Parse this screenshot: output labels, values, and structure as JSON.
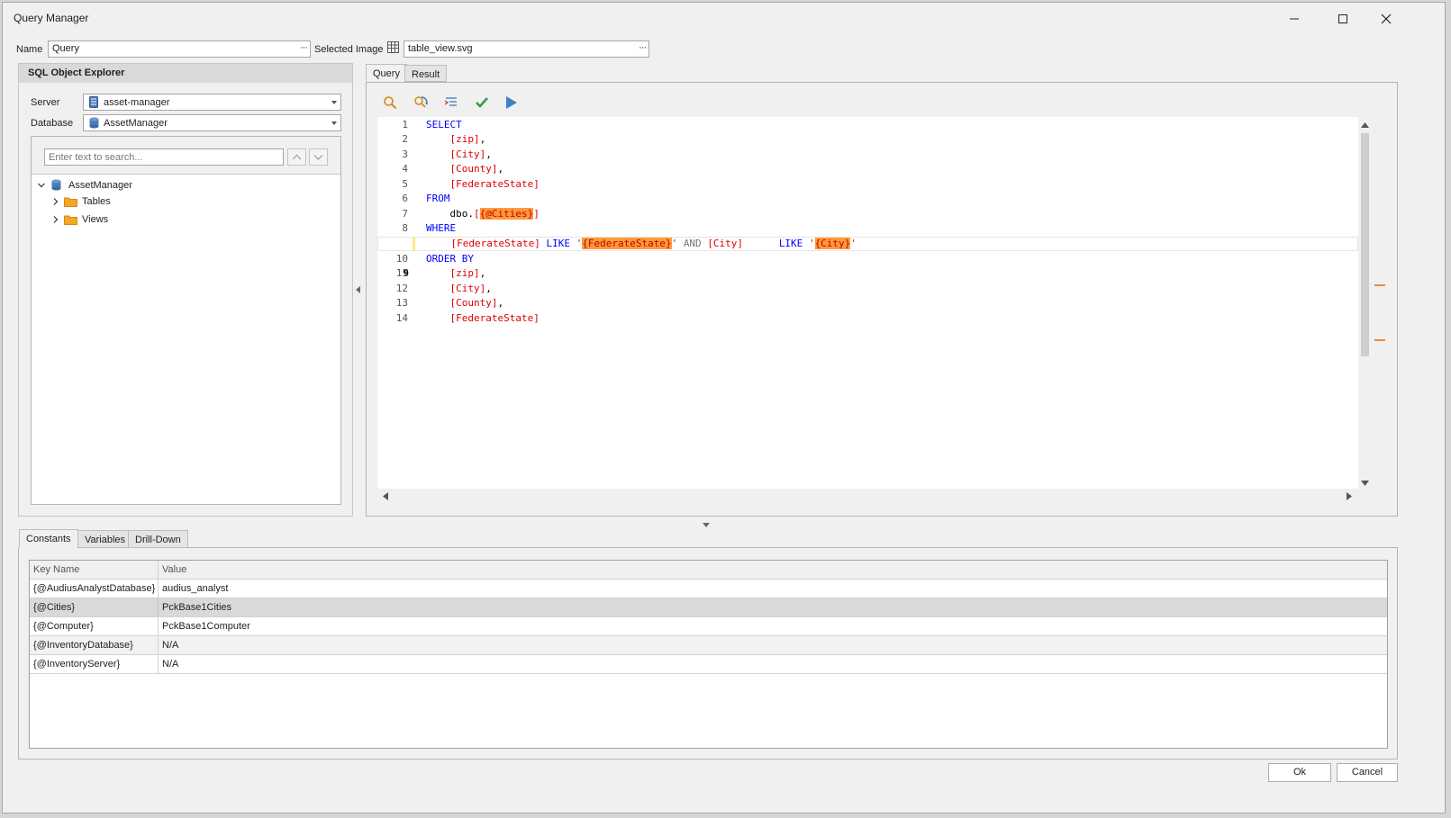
{
  "window": {
    "title": "Query Manager"
  },
  "form": {
    "name_label": "Name",
    "name_value": "Query",
    "selected_image_label": "Selected Image",
    "selected_image_value": "table_view.svg",
    "ellipsis": "···"
  },
  "explorer": {
    "header": "SQL Object Explorer",
    "server_label": "Server",
    "server_value": "asset-manager",
    "database_label": "Database",
    "database_value": "AssetManager",
    "search_placeholder": "Enter text to search...",
    "tree": {
      "root": "AssetManager",
      "children": [
        "Tables",
        "Views"
      ]
    }
  },
  "query_tabs": [
    "Query",
    "Result"
  ],
  "editor": {
    "current_line": 9
  },
  "bottom_tabs": [
    "Constants",
    "Variables",
    "Drill-Down"
  ],
  "constants_grid": {
    "columns": [
      "Key Name",
      "Value"
    ],
    "rows": [
      {
        "key": "{@AudiusAnalystDatabase}",
        "value": "audius_analyst"
      },
      {
        "key": "{@Cities}",
        "value": "PckBase1Cities"
      },
      {
        "key": "{@Computer}",
        "value": "PckBase1Computer"
      },
      {
        "key": "{@InventoryDatabase}",
        "value": "N/A"
      },
      {
        "key": "{@InventoryServer}",
        "value": "N/A"
      }
    ],
    "selected_row": 1
  },
  "footer": {
    "ok_label": "Ok",
    "cancel_label": "Cancel"
  },
  "colors": {
    "keyword": "#0000ff",
    "identifier": "#e00000",
    "highlight": "#ff9a3c",
    "accent_marker": "#f08a30"
  }
}
